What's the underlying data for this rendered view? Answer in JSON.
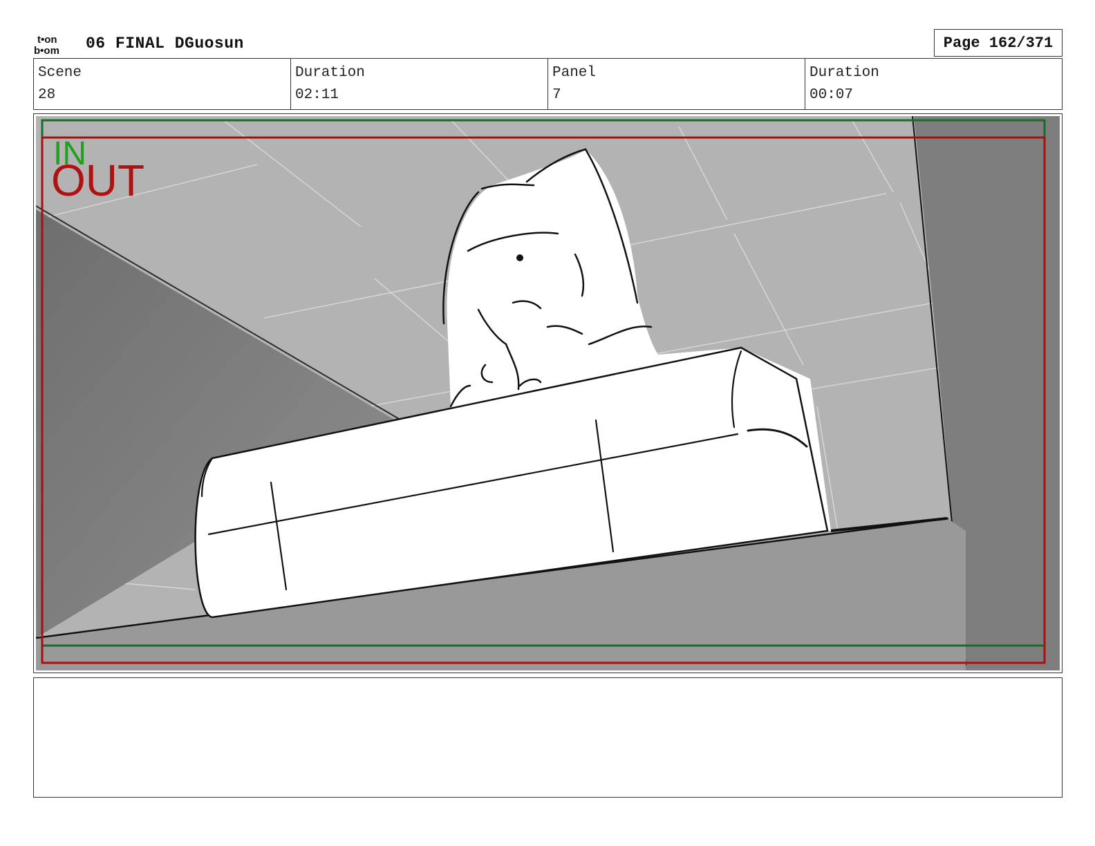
{
  "header": {
    "logo_top": "t•on",
    "logo_bottom": "b•om",
    "project_title": "06 FINAL DGuosun",
    "page_label": "Page 162/371"
  },
  "info": {
    "scene_label": "Scene",
    "scene_value": "28",
    "scene_duration_label": "Duration",
    "scene_duration_value": "02:11",
    "panel_label": "Panel",
    "panel_value": "7",
    "panel_duration_label": "Duration",
    "panel_duration_value": "00:07"
  },
  "panel": {
    "in_label": "IN",
    "out_label": "OUT",
    "in_color": "#1fa01f",
    "out_color": "#b01212"
  },
  "notes": {
    "text": ""
  }
}
